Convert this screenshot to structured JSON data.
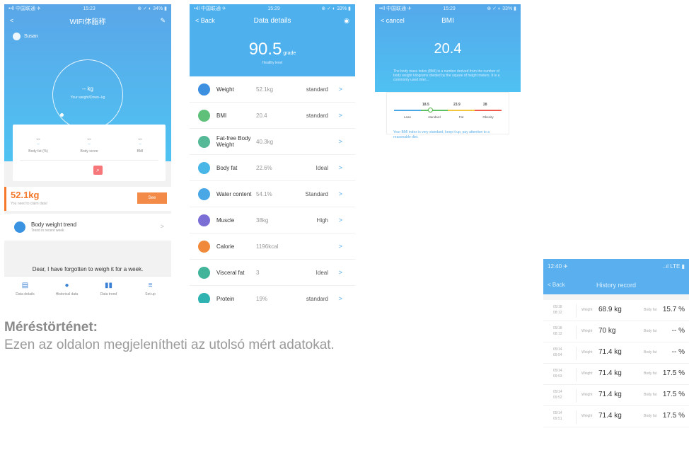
{
  "s1": {
    "status_left": "••ll 中国联通 ✈",
    "status_time": "15:23",
    "status_right": "⊕ ✓ ◐ 34% ▮",
    "title": "WIFI体脂称",
    "user": "Susan",
    "ring_value": "-- kg",
    "ring_sub": "Your weight/Down--kg",
    "metrics": [
      {
        "value": "--",
        "unit": "--",
        "label": "Body fat (%)"
      },
      {
        "value": "--",
        "unit": "--",
        "label": "Body score"
      },
      {
        "value": "--",
        "unit": "--",
        "label": "BMI"
      }
    ],
    "claim_weight": "52.1kg",
    "claim_note": "You need to claim data!",
    "see_label": "See",
    "trend_title": "Body weight trend",
    "trend_sub": "Trend in recent week",
    "forget_msg": "Dear, I have forgotten to weigh it for a week.",
    "tabs": [
      {
        "icon": "▤",
        "label": "Data details"
      },
      {
        "icon": "●",
        "label": "Historical data"
      },
      {
        "icon": "▮▮",
        "label": "Data trend"
      },
      {
        "icon": "≡",
        "label": "Set up"
      }
    ]
  },
  "s2": {
    "status_left": "••ll 中国联通 ✈",
    "status_time": "15:29",
    "status_right": "⊕ ✓ ◐ 33% ▮",
    "back": "< Back",
    "title": "Data details",
    "score": "90.5",
    "score_unit": "grade",
    "level": "Healthy level",
    "rows": [
      {
        "name": "Weight",
        "value": "52.1kg",
        "status": "standard",
        "color": "#3d8fe0"
      },
      {
        "name": "BMI",
        "value": "20.4",
        "status": "standard",
        "color": "#5fc07a"
      },
      {
        "name": "Fat-free Body Weight",
        "value": "40.3kg",
        "status": "",
        "color": "#55b896"
      },
      {
        "name": "Body fat",
        "value": "22.6%",
        "status": "Ideal",
        "color": "#49b6e8"
      },
      {
        "name": "Water content",
        "value": "54.1%",
        "status": "Standard",
        "color": "#4aa7e6"
      },
      {
        "name": "Muscle",
        "value": "38kg",
        "status": "High",
        "color": "#7b6fd6"
      },
      {
        "name": "Calorie",
        "value": "1196kcal",
        "status": "",
        "color": "#f08a3a"
      },
      {
        "name": "Visceral fat",
        "value": "3",
        "status": "Ideal",
        "color": "#42b49a"
      },
      {
        "name": "Protein",
        "value": "19%",
        "status": "standard",
        "color": "#2fb3b0"
      }
    ]
  },
  "s3": {
    "status_left": "••ll 中国联通 ✈",
    "status_time": "15:29",
    "status_right": "⊕ ✓ ◐ 33% ▮",
    "cancel": "< cancel",
    "title": "BMI",
    "value": "20.4",
    "description": "The body mass index (BMI) is a number derived from the number of body weight kilograms divided by the square of height meters. It is a commonly used inter...",
    "ticks": [
      "18.5",
      "23.9",
      "28"
    ],
    "categories": [
      "Lean",
      "standard",
      "Fat",
      "Obesity"
    ],
    "scale_colors": [
      "#4aa7e6",
      "#5cc064",
      "#f2c53d",
      "#ee5b4e"
    ],
    "tip": "Your BMI index is very standard, keep it up, pay attention to a reasonable diet."
  },
  "s4": {
    "status_time": "12:40 ✈",
    "status_right": "..ıl LTE ▮",
    "back": "< Back",
    "title": "History record",
    "weight_label": "Weight",
    "fat_label": "Body fat",
    "records": [
      {
        "date": "05/18",
        "time": "08:12",
        "weight": "68.9 kg",
        "fat": "15.7 %"
      },
      {
        "date": "05/18",
        "time": "08:12",
        "weight": "70 kg",
        "fat": "-- %"
      },
      {
        "date": "05/14",
        "time": "09:54",
        "weight": "71.4 kg",
        "fat": "-- %"
      },
      {
        "date": "05/14",
        "time": "09:53",
        "weight": "71.4 kg",
        "fat": "17.5 %"
      },
      {
        "date": "05/14",
        "time": "09:52",
        "weight": "71.4 kg",
        "fat": "17.5 %"
      },
      {
        "date": "05/14",
        "time": "09:51",
        "weight": "71.4 kg",
        "fat": "17.5 %"
      }
    ]
  },
  "caption": {
    "title": "Méréstörténet:",
    "subtitle": "Ezen az oldalon megjelenítheti az utolsó mért adatokat."
  }
}
